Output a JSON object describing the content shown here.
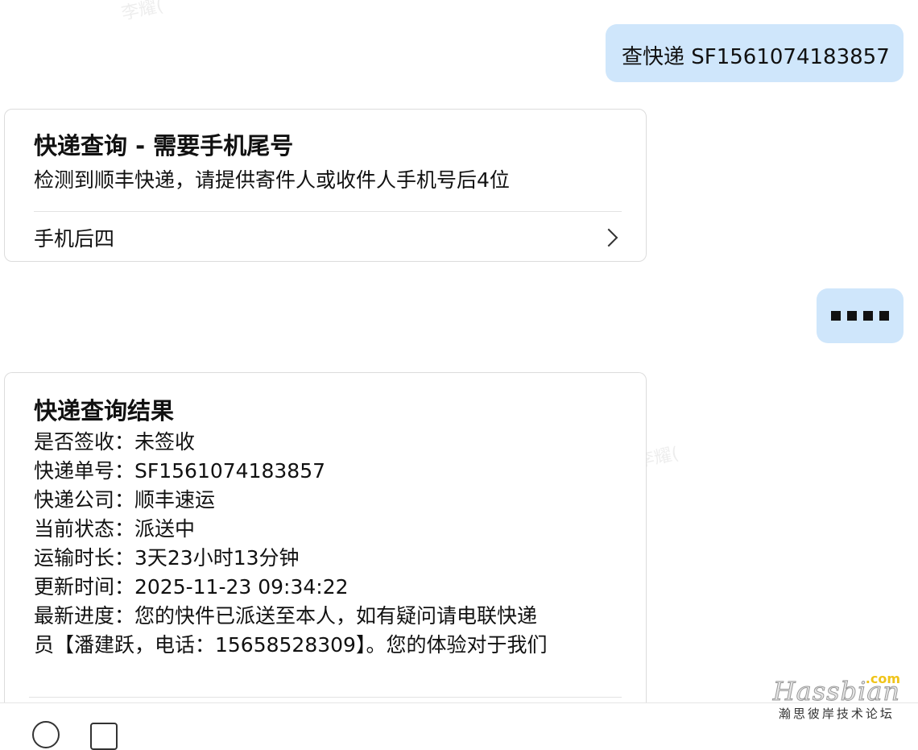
{
  "watermark": "李耀(",
  "messages": {
    "user1": "查快递 SF1561074183857",
    "card1": {
      "title": "快递查询 - 需要手机尾号",
      "desc": "检测到顺丰快递，请提供寄件人或收件人手机号后4位",
      "action": "手机后四"
    },
    "card2": {
      "title": "快递查询结果",
      "lines": [
        "是否签收：未签收",
        "快递单号：SF1561074183857",
        "快递公司：顺丰速运",
        "当前状态：派送中",
        "运输时长：3天23小时13分钟",
        "更新时间：2025-11-23 09:34:22",
        "最新进度：您的快件已派送至本人，如有疑问请电联快递",
        "员【潘建跃，电话：15658528309】。您的体验对于我们"
      ]
    }
  },
  "logo": {
    "com": ".com",
    "name": "Hassbian",
    "sub": "瀚思彼岸技术论坛"
  }
}
